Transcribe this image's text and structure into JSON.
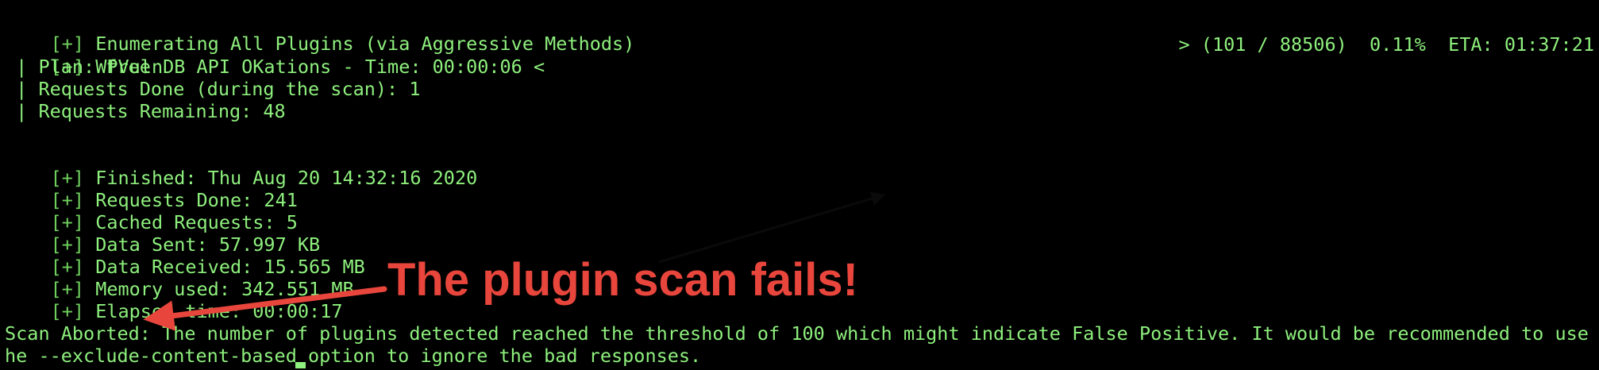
{
  "terminal": {
    "prefix": "[+]",
    "lines": {
      "enumerating": "Enumerating All Plugins (via Aggressive Methods)",
      "api_status": "WPVulnDB API OKations - Time: 00:00:06 <",
      "plan": " | Plan: free",
      "requests_during_scan": " | Requests Done (during the scan): 1",
      "requests_remaining": " | Requests Remaining: 48",
      "finished": "Finished: Thu Aug 20 14:32:16 2020",
      "requests_done": "Requests Done: 241",
      "cached_requests": "Cached Requests: 5",
      "data_sent": "Data Sent: 57.997 KB",
      "data_received": "Data Received: 15.565 MB",
      "memory_used": "Memory used: 342.551 MB",
      "elapsed_time": "Elapsed time: 00:00:17",
      "scan_aborted_1": "Scan Aborted: The number of plugins detected reached the threshold of 100 which might indicate False Positive. It would be recommended to use t",
      "scan_aborted_2": "he --exclude-content-based option to ignore the bad responses."
    },
    "progress": "> (101 / 88506)  0.11%  ETA: 01:37:21"
  },
  "annotation": {
    "text": "The plugin scan fails!",
    "color": "#e8463c"
  },
  "colors": {
    "background": "#000000",
    "terminal_text": "#8ef07d",
    "bracket": "#6fcf5d"
  }
}
